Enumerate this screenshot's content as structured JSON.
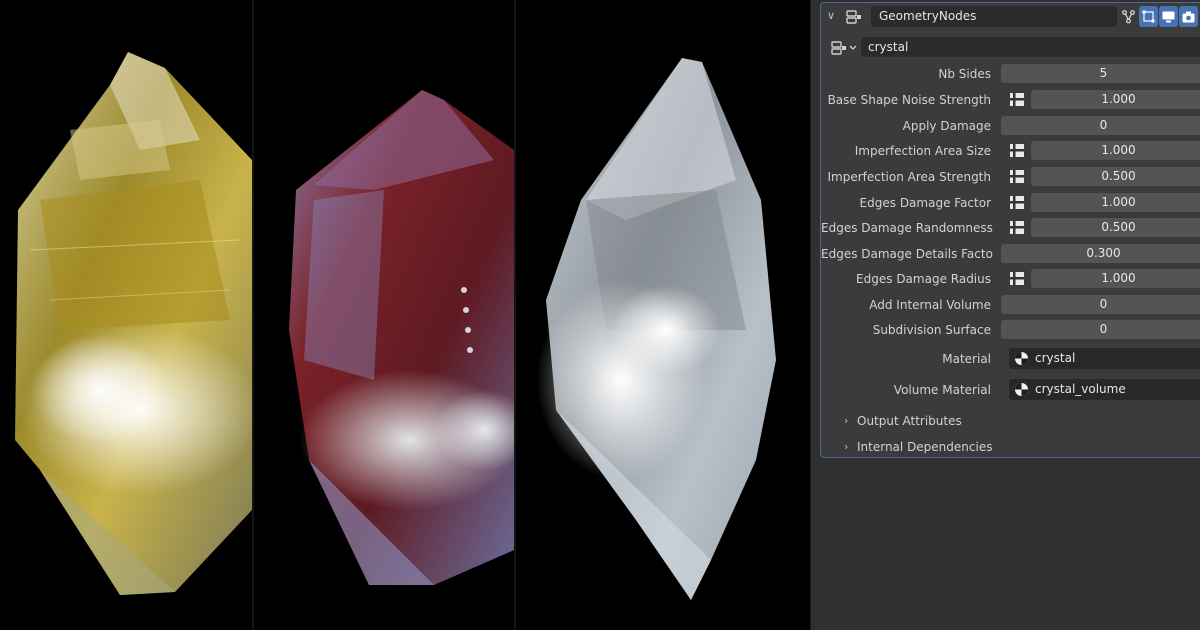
{
  "modifier": {
    "name": "GeometryNodes",
    "node_group": "crystal",
    "header_icons": [
      "geometry-nodes-icon",
      "edit-mode-icon",
      "viewport-display-icon",
      "render-icon"
    ]
  },
  "inputs": [
    {
      "label": "Nb Sides",
      "value": "5",
      "attribute_toggle": false
    },
    {
      "label": "Base Shape Noise Strength",
      "value": "1.000",
      "attribute_toggle": true
    },
    {
      "label": "Apply Damage",
      "value": "0",
      "attribute_toggle": false
    },
    {
      "label": "Imperfection Area Size",
      "value": "1.000",
      "attribute_toggle": true
    },
    {
      "label": "Imperfection Area Strength",
      "value": "0.500",
      "attribute_toggle": true
    },
    {
      "label": "Edges Damage Factor",
      "value": "1.000",
      "attribute_toggle": true
    },
    {
      "label": "Edges Damage Randomness",
      "value": "0.500",
      "attribute_toggle": true
    },
    {
      "label": "Edges Damage Details Facto",
      "value": "0.300",
      "attribute_toggle": false
    },
    {
      "label": "Edges Damage Radius",
      "value": "1.000",
      "attribute_toggle": true
    },
    {
      "label": "Add Internal Volume",
      "value": "0",
      "attribute_toggle": false
    },
    {
      "label": "Subdivision Surface",
      "value": "0",
      "attribute_toggle": false
    }
  ],
  "materials": [
    {
      "label": "Material",
      "value": "crystal"
    },
    {
      "label": "Volume Material",
      "value": "crystal_volume"
    }
  ],
  "subpanels": [
    {
      "label": "Output Attributes"
    },
    {
      "label": "Internal Dependencies"
    }
  ],
  "colors": {
    "panel_bg": "#303030",
    "modifier_bg": "#3b3b3b",
    "field_bg": "#545454",
    "accent_blue": "#4772b3",
    "selection_outline": "#4c6a9a"
  },
  "renders": [
    {
      "tint": "gold"
    },
    {
      "tint": "red"
    },
    {
      "tint": "clear"
    }
  ]
}
